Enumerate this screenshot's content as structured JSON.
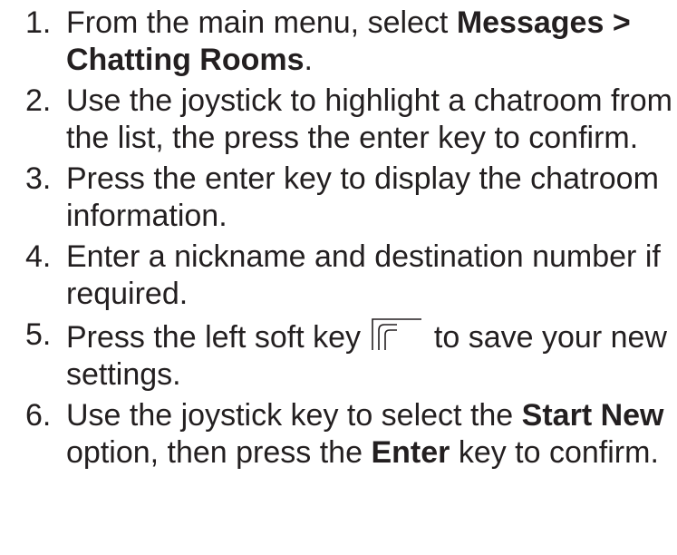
{
  "steps": [
    {
      "number": "1.",
      "text_1": "From the main menu, select ",
      "bold_1": "Messages > Chatting Rooms",
      "text_2": "."
    },
    {
      "number": "2.",
      "text": "Use the joystick to highlight a chatroom from the list, the press the enter key to confirm."
    },
    {
      "number": "3.",
      "text": "Press the enter key to display the chatroom information."
    },
    {
      "number": "4.",
      "text": "Enter a nickname and destination number if required."
    },
    {
      "number": "5.",
      "text_1": "Press the left soft key",
      "icon": "left-soft-key-icon",
      "text_2": " to save your new settings."
    },
    {
      "number": "6.",
      "text_1": "Use the joystick key to select the ",
      "bold_1": "Start New",
      "text_2": " option, then press the ",
      "bold_2": "Enter",
      "text_3": " key to confirm."
    }
  ]
}
